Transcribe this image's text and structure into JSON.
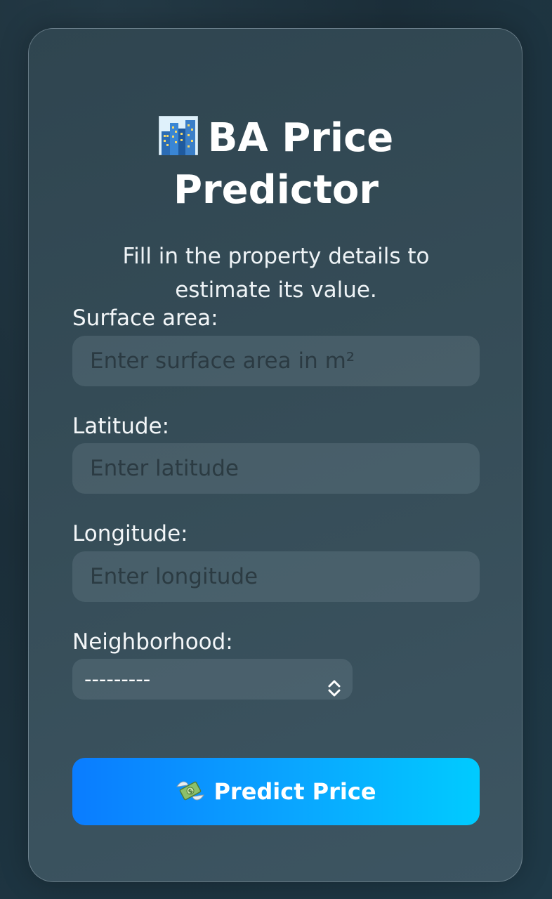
{
  "header": {
    "title_icon": "cityscape-icon",
    "title_line1": "BA Price",
    "title_line2": "Predictor",
    "subtitle": "Fill in the property details to estimate its value."
  },
  "form": {
    "surface": {
      "label": "Surface area:",
      "placeholder": "Enter surface area in m²",
      "value": ""
    },
    "latitude": {
      "label": "Latitude:",
      "placeholder": "Enter latitude",
      "value": ""
    },
    "longitude": {
      "label": "Longitude:",
      "placeholder": "Enter longitude",
      "value": ""
    },
    "neighborhood": {
      "label": "Neighborhood:",
      "selected": "---------"
    }
  },
  "actions": {
    "predict_icon": "money-with-wings-icon",
    "predict_label": "Predict Price"
  },
  "colors": {
    "button_start": "#0a7cff",
    "button_end": "#00cbff"
  }
}
